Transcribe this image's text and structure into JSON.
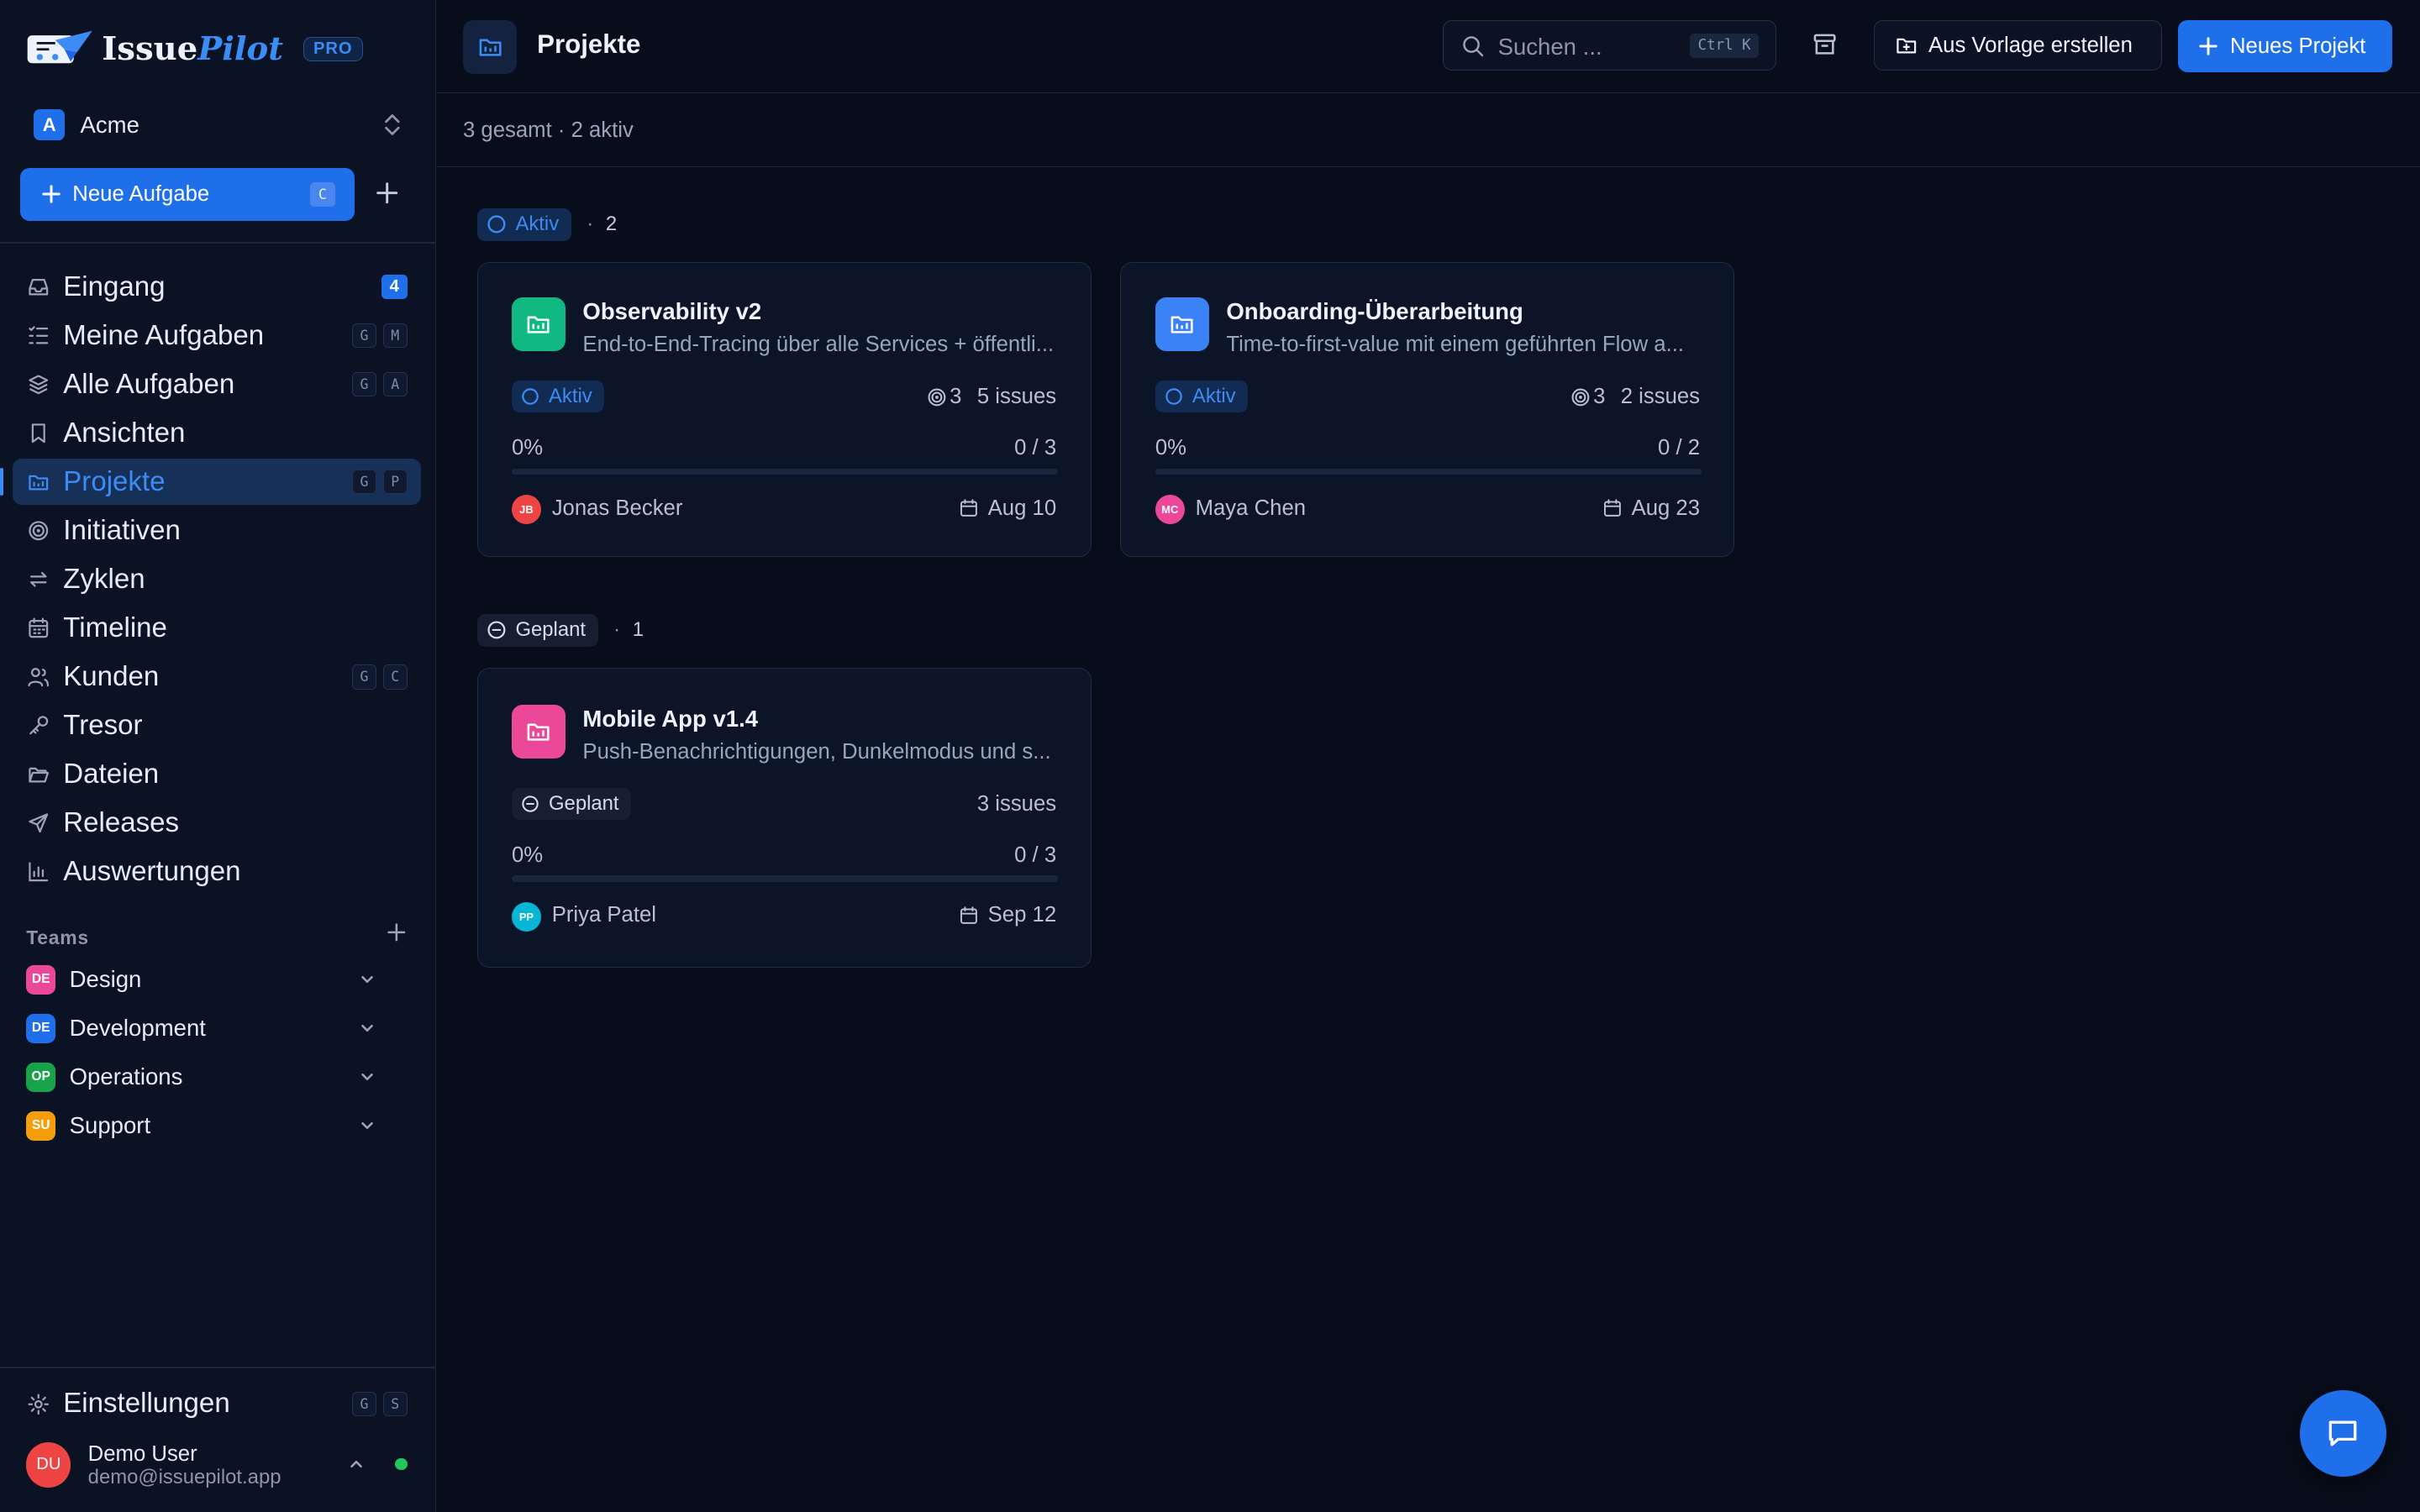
{
  "app": {
    "logo_part1": "Issue",
    "logo_part2": "Pilot",
    "plan_badge": "PRO"
  },
  "workspace": {
    "initial": "A",
    "name": "Acme"
  },
  "sidebar": {
    "new_task_label": "Neue Aufgabe",
    "new_task_shortcut": "C",
    "nav": [
      {
        "label": "Eingang",
        "icon": "inbox-icon",
        "badge": "4"
      },
      {
        "label": "Meine Aufgaben",
        "icon": "list-check-icon",
        "keys": [
          "G",
          "M"
        ]
      },
      {
        "label": "Alle Aufgaben",
        "icon": "layers-icon",
        "keys": [
          "G",
          "A"
        ]
      },
      {
        "label": "Ansichten",
        "icon": "bookmark-icon"
      },
      {
        "label": "Projekte",
        "icon": "project-folder-icon",
        "keys": [
          "G",
          "P"
        ],
        "active": true
      },
      {
        "label": "Initiativen",
        "icon": "target-icon"
      },
      {
        "label": "Zyklen",
        "icon": "cycle-arrows-icon"
      },
      {
        "label": "Timeline",
        "icon": "calendar-icon"
      },
      {
        "label": "Kunden",
        "icon": "users-icon",
        "keys": [
          "G",
          "C"
        ]
      },
      {
        "label": "Tresor",
        "icon": "key-icon"
      },
      {
        "label": "Dateien",
        "icon": "folder-open-icon"
      },
      {
        "label": "Releases",
        "icon": "send-icon"
      },
      {
        "label": "Auswertungen",
        "icon": "bar-chart-icon"
      }
    ],
    "teams_label": "Teams",
    "teams": [
      {
        "initials": "DE",
        "name": "Design",
        "color": "#ec4899"
      },
      {
        "initials": "DE",
        "name": "Development",
        "color": "#1f6feb"
      },
      {
        "initials": "OP",
        "name": "Operations",
        "color": "#16a34a"
      },
      {
        "initials": "SU",
        "name": "Support",
        "color": "#f59e0b"
      }
    ],
    "settings_label": "Einstellungen",
    "settings_keys": [
      "G",
      "S"
    ],
    "user": {
      "initials": "DU",
      "name": "Demo User",
      "email": "demo@issuepilot.app"
    }
  },
  "header": {
    "title": "Projekte",
    "search_placeholder": "Suchen ...",
    "search_shortcut": "Ctrl K",
    "template_button": "Aus Vorlage erstellen",
    "new_project_button": "Neues Projekt"
  },
  "summary": "3 gesamt · 2 aktiv",
  "groups": {
    "active": {
      "label": "Aktiv",
      "separator": "·",
      "count": "2"
    },
    "planned": {
      "label": "Geplant",
      "separator": "·",
      "count": "1"
    }
  },
  "projects": [
    {
      "title": "Observability v2",
      "description": "End-to-End-Tracing über alle Services + öffentli...",
      "status": "Aktiv",
      "targets": "3",
      "issues": "5 issues",
      "progress_percent": 0,
      "progress_label": "0%",
      "progress_fraction": "0 / 3",
      "lead_initials": "JB",
      "lead_name": "Jonas Becker",
      "lead_color": "#ef4444",
      "due": "Aug 10",
      "icon_color": "#10b981"
    },
    {
      "title": "Onboarding-Überarbeitung",
      "description": "Time-to-first-value mit einem geführten Flow a...",
      "status": "Aktiv",
      "targets": "3",
      "issues": "2 issues",
      "progress_percent": 0,
      "progress_label": "0%",
      "progress_fraction": "0 / 2",
      "lead_initials": "MC",
      "lead_name": "Maya Chen",
      "lead_color": "#ec4899",
      "due": "Aug 23",
      "icon_color": "#3b82f6"
    },
    {
      "title": "Mobile App v1.4",
      "description": "Push-Benachrichtigungen, Dunkelmodus und s...",
      "status": "Geplant",
      "issues": "3 issues",
      "progress_percent": 0,
      "progress_label": "0%",
      "progress_fraction": "0 / 3",
      "lead_initials": "PP",
      "lead_name": "Priya Patel",
      "lead_color": "#06b6d4",
      "due": "Sep 12",
      "icon_color": "#ec4899"
    }
  ],
  "colors": {
    "accent": "#1f6feb",
    "accent_text": "#3b8cf5",
    "background": "#070d1a",
    "sidebar": "#0a1224"
  }
}
